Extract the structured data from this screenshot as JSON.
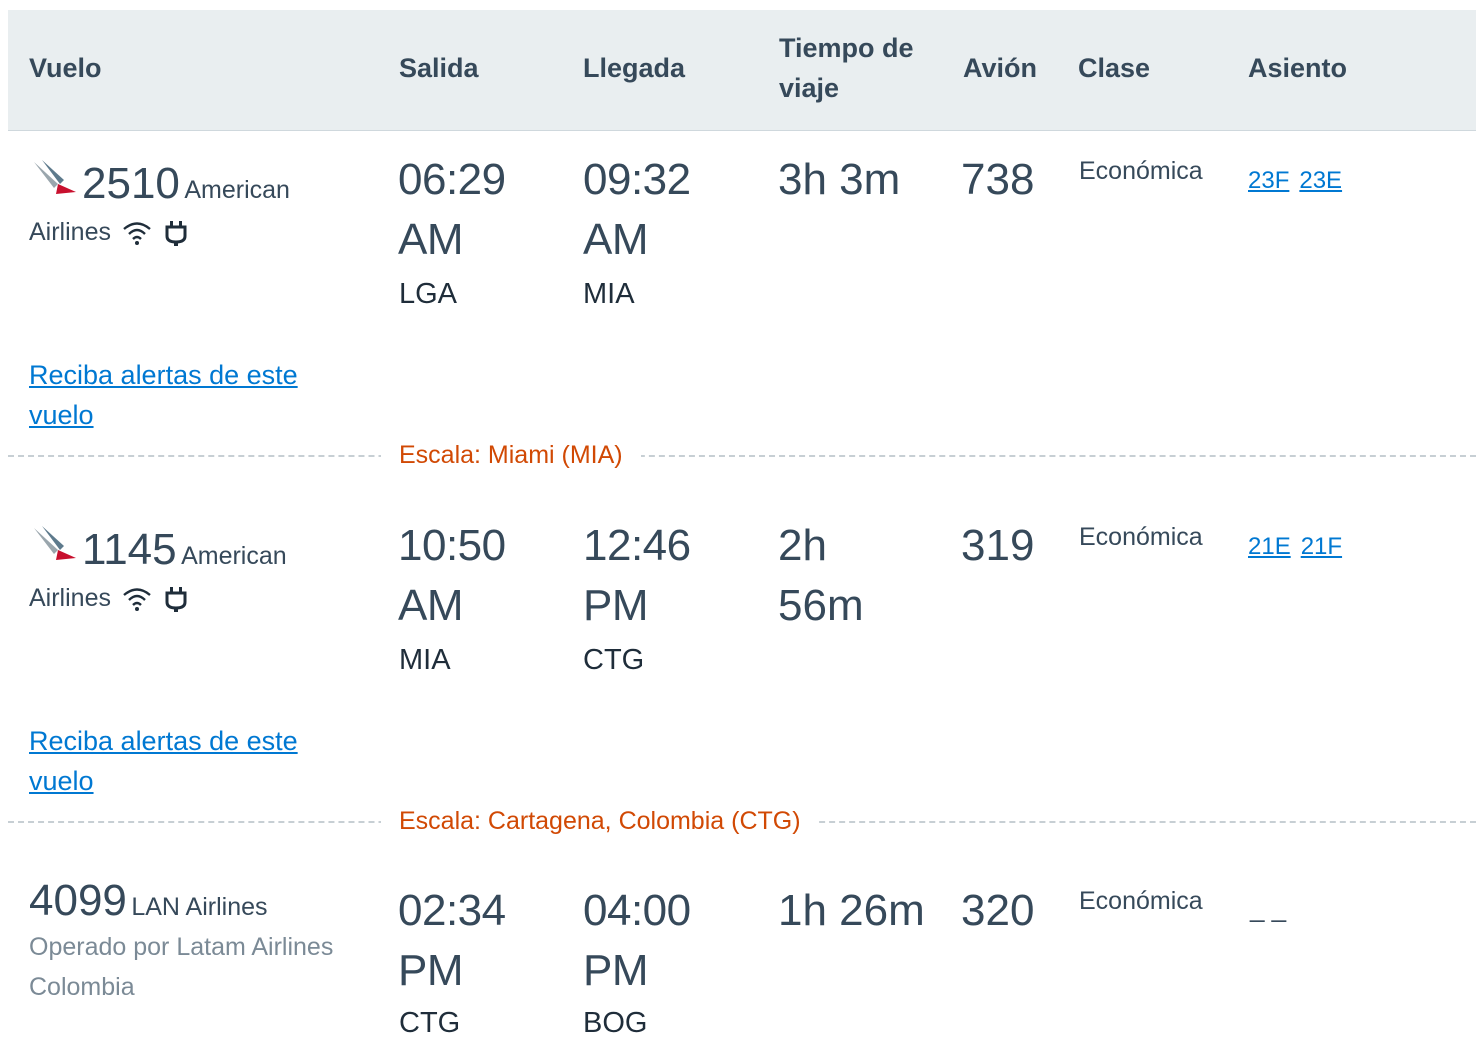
{
  "header": {
    "flight": "Vuelo",
    "departure": "Salida",
    "arrival": "Llegada",
    "duration_line1": "Tiempo de",
    "duration_line2": "viaje",
    "aircraft": "Avión",
    "class": "Clase",
    "seat": "Asiento"
  },
  "segments": [
    {
      "flight_number": "2510",
      "airline_line1": "American",
      "airline_line2": "Airlines",
      "dep_time_1": "06:29",
      "dep_time_2": "AM",
      "dep_code": "LGA",
      "arr_time_1": "09:32",
      "arr_time_2": "AM",
      "arr_code": "MIA",
      "duration_1": "3h 3m",
      "duration_2": "",
      "aircraft": "738",
      "class": "Económica",
      "seats": [
        "23F",
        "23E"
      ],
      "alert_line1": "Reciba alertas de este",
      "alert_line2": "vuelo"
    },
    {
      "flight_number": "1145",
      "airline_line1": "American",
      "airline_line2": "Airlines",
      "dep_time_1": "10:50",
      "dep_time_2": "AM",
      "dep_code": "MIA",
      "arr_time_1": "12:46",
      "arr_time_2": "PM",
      "arr_code": "CTG",
      "duration_1": "2h",
      "duration_2": "56m",
      "aircraft": "319",
      "class": "Económica",
      "seats": [
        "21E",
        "21F"
      ],
      "alert_line1": "Reciba alertas de este",
      "alert_line2": "vuelo"
    },
    {
      "flight_number": "4099",
      "airline_line1": "LAN Airlines",
      "operated_line1": "Operado por Latam Airlines",
      "operated_line2": "Colombia",
      "dep_time_1": "02:34",
      "dep_time_2": "PM",
      "dep_code": "CTG",
      "arr_time_1": "04:00",
      "arr_time_2": "PM",
      "arr_code": "BOG",
      "duration_1": "1h 26m",
      "aircraft": "320",
      "class": "Económica",
      "seat_placeholder": "_ _"
    }
  ],
  "stops": [
    "Escala: Miami (MIA)",
    "Escala: Cartagena, Colombia (CTG)"
  ],
  "icons": {
    "airline_logo": "american-airlines-logo-icon",
    "wifi": "wifi-icon",
    "power": "power-outlet-icon"
  },
  "colors": {
    "link": "#0078d2",
    "stop_label": "#d14904",
    "header_bg": "#e9eef0",
    "text": "#36495a"
  }
}
